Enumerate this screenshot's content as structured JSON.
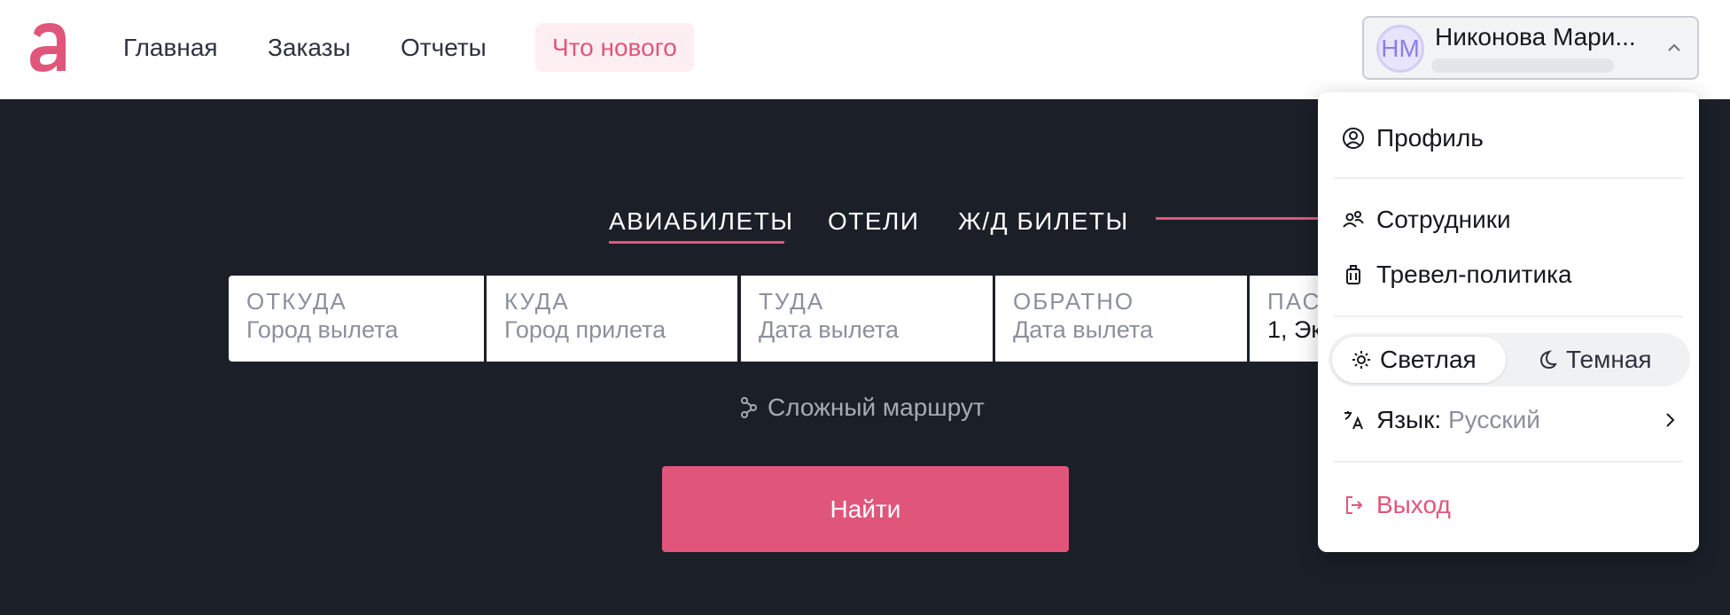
{
  "header": {
    "logo_icon": "brand-logo-a",
    "nav": [
      "Главная",
      "Заказы",
      "Отчеты"
    ],
    "whats_new": "Что нового",
    "user": {
      "initials": "НМ",
      "name": "Никонова Мари..."
    }
  },
  "search": {
    "tabs": [
      "АВИАБИЛЕТЫ",
      "ОТЕЛИ",
      "Ж/Д БИЛЕТЫ"
    ],
    "active_tab": "АВИАБИЛЕТЫ",
    "fields": [
      {
        "label": "ОТКУДА",
        "value": "Город вылета"
      },
      {
        "label": "КУДА",
        "value": "Город прилета"
      },
      {
        "label": "ТУДА",
        "value": "Дата вылета"
      },
      {
        "label": "ОБРАТНО",
        "value": "Дата вылета"
      },
      {
        "label": "ПАС",
        "value": "1, Эк"
      }
    ],
    "complex_route": "Сложный маршрут",
    "find_button": "Найти"
  },
  "dropdown": {
    "profile": "Профиль",
    "staff": "Сотрудники",
    "travel_policy": "Тревел-политика",
    "theme": {
      "light": "Светлая",
      "dark": "Темная",
      "selected": "Светлая"
    },
    "language_label": "Язык:",
    "language_value": "Русский",
    "logout": "Выход"
  },
  "colors": {
    "accent": "#e0567a",
    "background": "#1b1f28",
    "header_bg": "#ffffff"
  }
}
